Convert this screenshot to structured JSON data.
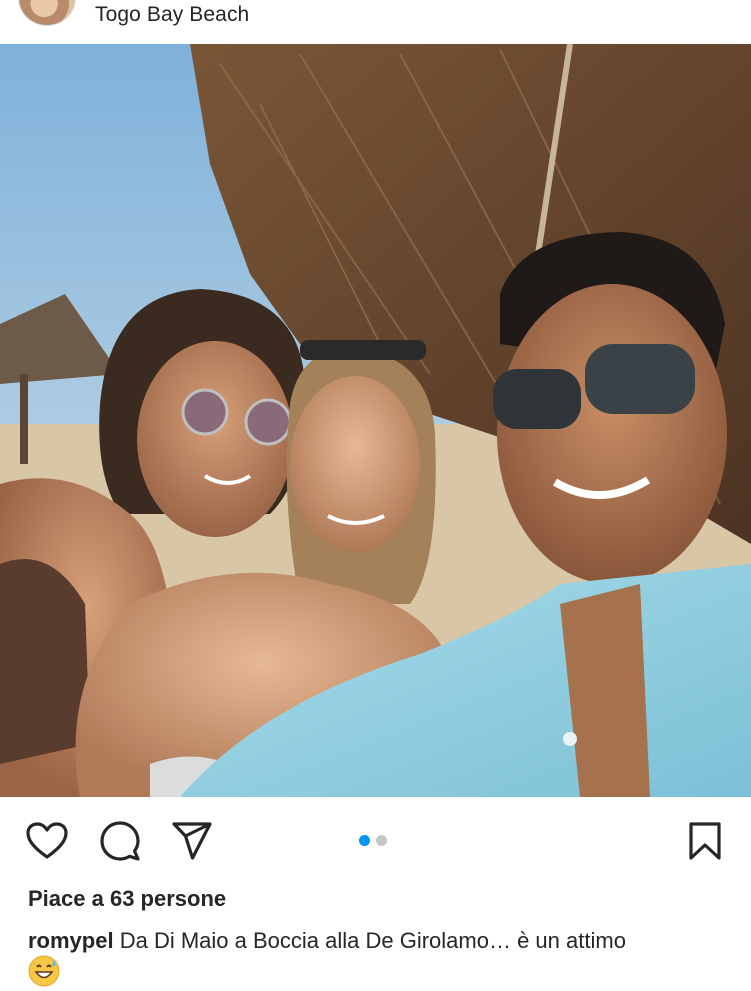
{
  "post": {
    "location": "Togo Bay Beach",
    "likes_text": "Piace a 63 persone",
    "caption_user": "romypel",
    "caption_text": "Da Di Maio a Boccia alla De Girolamo… è un attimo",
    "emoji": "grinning-face-with-sweat-emoji",
    "carousel": {
      "current": 1,
      "total": 2
    }
  },
  "colors": {
    "accent": "#0095f6",
    "text": "#262626",
    "dot_inactive": "#c7c7c7"
  },
  "icons": {
    "like": "heart-icon",
    "comment": "comment-bubble-icon",
    "share": "paper-plane-icon",
    "save": "bookmark-icon"
  }
}
